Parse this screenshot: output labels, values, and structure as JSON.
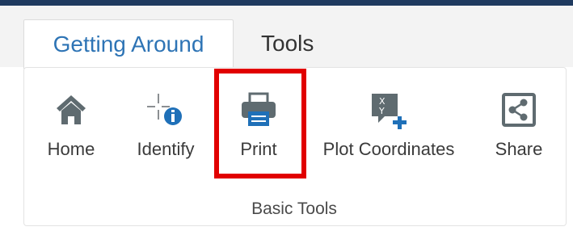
{
  "tabs": [
    {
      "label": "Getting Around",
      "active": true
    },
    {
      "label": "Tools",
      "active": false
    }
  ],
  "ribbon": {
    "group_label": "Basic Tools",
    "tools": [
      {
        "label": "Home",
        "icon": "home-icon"
      },
      {
        "label": "Identify",
        "icon": "identify-icon"
      },
      {
        "label": "Print",
        "icon": "print-icon"
      },
      {
        "label": "Plot Coordinates",
        "icon": "plot-coordinates-icon"
      },
      {
        "label": "Share",
        "icon": "share-icon"
      }
    ]
  },
  "colors": {
    "accent": "#2e74b5",
    "icon_gray": "#5f6b70",
    "icon_blue": "#1f70b8",
    "highlight": "#e10000",
    "topbar": "#1f3a5f"
  }
}
